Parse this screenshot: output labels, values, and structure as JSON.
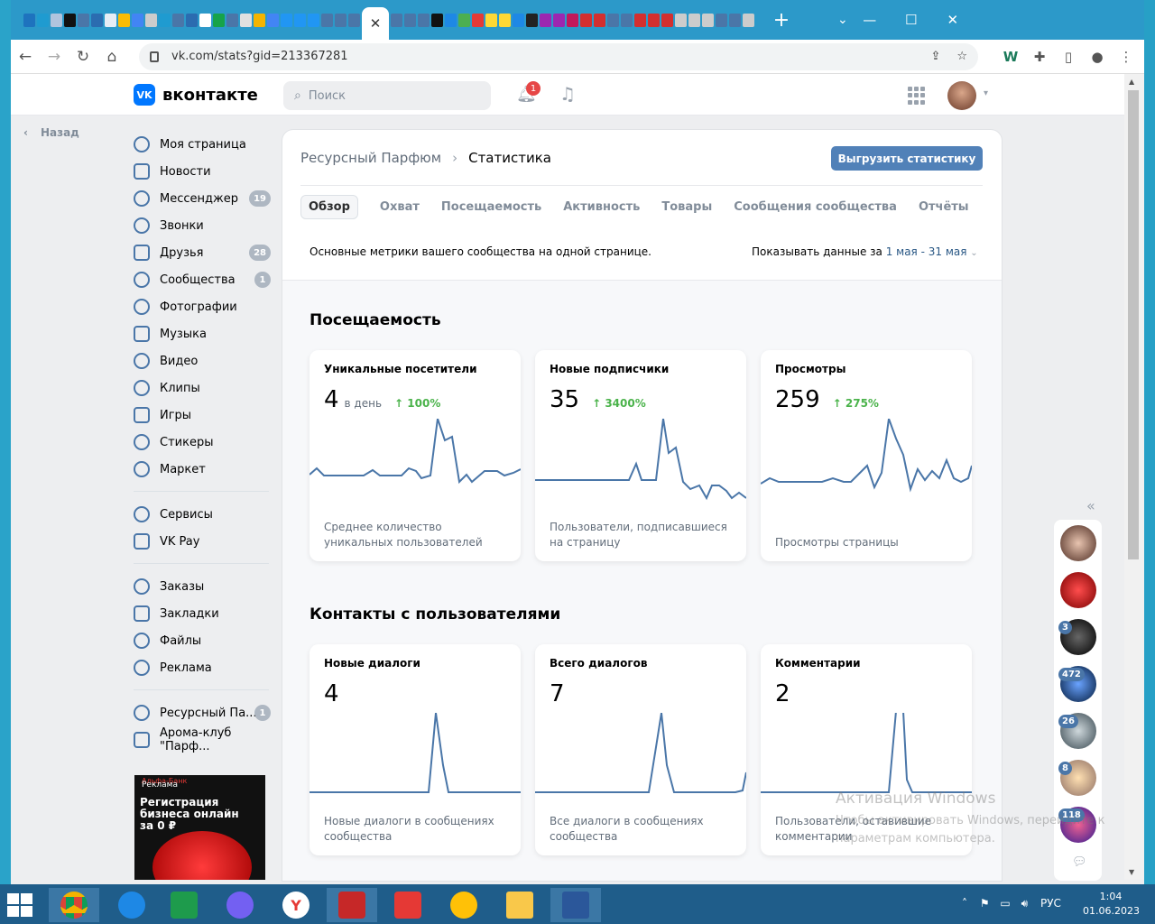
{
  "browser": {
    "tab_colors": [
      "#1e73be",
      "#1f9bd0",
      "#b0c4de",
      "#111",
      "#4a76a8",
      "#2b6cb0",
      "#e6edf5",
      "#fbbc05",
      "#4285f4",
      "#ccc",
      "#1f9bd0",
      "#4a76a8",
      "#2b6cb0",
      "#fff",
      "#16a34a",
      "#4a76a8",
      "#e0e0e0",
      "#f4b400",
      "#4285f4",
      "#2196f3",
      "#2196f3",
      "#2196f3",
      "#4a76a8",
      "#4a76a8",
      "#4a76a8"
    ],
    "active_tab_icon": "✕",
    "right_tab_colors": [
      "#4a76a8",
      "#4a76a8",
      "#4a76a8",
      "#111",
      "#1e88e5",
      "#4caf50",
      "#e53935",
      "#fdd835",
      "#fdd835",
      "#1e88e5",
      "#222",
      "#9c27b0",
      "#9c27b0",
      "#c2185b",
      "#d32f2f",
      "#d32f2f",
      "#4a76a8",
      "#4a76a8",
      "#d32f2f",
      "#d32f2f",
      "#d32f2f",
      "#ccc",
      "#ccc",
      "#ccc",
      "#4a76a8",
      "#4a76a8",
      "#ccc"
    ],
    "new_tab": "+",
    "url": "vk.com/stats?gid=213367281"
  },
  "vk": {
    "logo_mark": "VK",
    "logo_text": "вконтакте",
    "search_placeholder": "Поиск",
    "notif_count": "1",
    "back_label": "Назад"
  },
  "sidebar": {
    "items": [
      {
        "label": "Моя страница",
        "count": ""
      },
      {
        "label": "Новости",
        "count": ""
      },
      {
        "label": "Мессенджер",
        "count": "19"
      },
      {
        "label": "Звонки",
        "count": ""
      },
      {
        "label": "Друзья",
        "count": "28"
      },
      {
        "label": "Сообщества",
        "count": "1"
      },
      {
        "label": "Фотографии",
        "count": ""
      },
      {
        "label": "Музыка",
        "count": ""
      },
      {
        "label": "Видео",
        "count": ""
      },
      {
        "label": "Клипы",
        "count": ""
      },
      {
        "label": "Игры",
        "count": ""
      },
      {
        "label": "Стикеры",
        "count": ""
      },
      {
        "label": "Маркет",
        "count": ""
      }
    ],
    "items2": [
      {
        "label": "Сервисы",
        "count": ""
      },
      {
        "label": "VK Pay",
        "count": ""
      }
    ],
    "items3": [
      {
        "label": "Заказы",
        "count": ""
      },
      {
        "label": "Закладки",
        "count": ""
      },
      {
        "label": "Файлы",
        "count": ""
      },
      {
        "label": "Реклама",
        "count": ""
      }
    ],
    "items4": [
      {
        "label": "Ресурсный Па...",
        "count": "1"
      },
      {
        "label": "Арома-клуб \"Парф...",
        "count": ""
      }
    ],
    "ad": {
      "brand": "Альфа-Банк",
      "label": "Реклама",
      "text": "Регистрация бизнеса онлайн за 0 ₽"
    }
  },
  "stats": {
    "breadcrumb_group": "Ресурсный Парфюм",
    "breadcrumb_current": "Статистика",
    "export_button": "Выгрузить статистику",
    "tabs": [
      "Обзор",
      "Охват",
      "Посещаемость",
      "Активность",
      "Товары",
      "Сообщения сообщества",
      "Отчёты"
    ],
    "description": "Основные метрики вашего сообщества на одной странице.",
    "period_label": "Показывать данные за",
    "period_value": "1 мая - 31 мая",
    "section1_title": "Посещаемость",
    "section2_title": "Контакты с пользователями",
    "cards1": [
      {
        "title": "Уникальные посетители",
        "value": "4",
        "unit": "в день",
        "change": "100%",
        "caption": "Среднее количество уникальных пользователей"
      },
      {
        "title": "Новые подписчики",
        "value": "35",
        "unit": "",
        "change": "3400%",
        "caption": "Пользователи, подписавшиеся на страницу"
      },
      {
        "title": "Просмотры",
        "value": "259",
        "unit": "",
        "change": "275%",
        "caption": "Просмотры страницы"
      }
    ],
    "cards2": [
      {
        "title": "Новые диалоги",
        "value": "4",
        "caption": "Новые диалоги в сообщениях сообщества"
      },
      {
        "title": "Всего диалогов",
        "value": "7",
        "caption": "Все диалоги в сообщениях сообщества"
      },
      {
        "title": "Комментарии",
        "value": "2",
        "caption": "Пользователи, оставившие комментарии"
      }
    ],
    "line_color": "#4a76a8"
  },
  "right_panel": {
    "badges": [
      "3",
      "472",
      "26",
      "8",
      "118"
    ]
  },
  "os": {
    "watermark_title": "Активация Windows",
    "watermark_text": "Чтобы активировать Windows, перейдите к параметрам компьютера.",
    "language": "РУС",
    "time": "1:04",
    "date": "01.06.2023"
  }
}
